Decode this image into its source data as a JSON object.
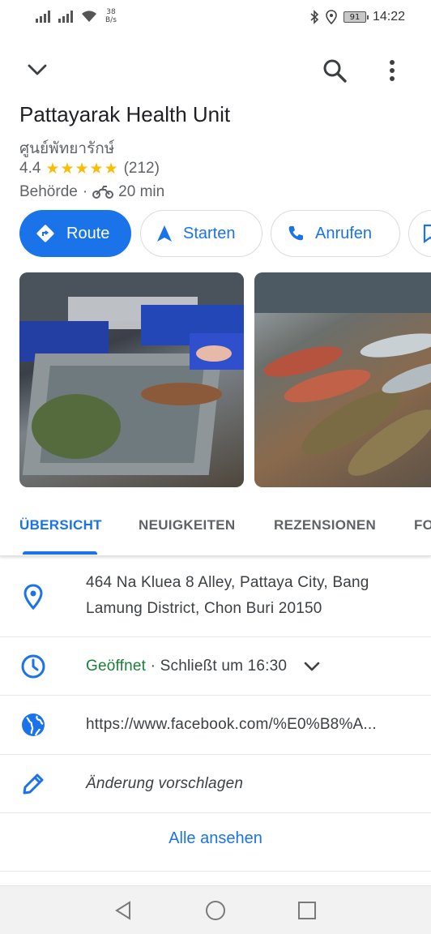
{
  "status_bar": {
    "net_speed_value": "38",
    "net_speed_unit": "B/s",
    "battery": "91",
    "time": "14:22"
  },
  "place": {
    "name": "Pattayarak Health Unit",
    "native_name": "ศูนย์พัทยารักษ์",
    "rating": "4.4",
    "stars": "★★★★★",
    "review_count": "(212)",
    "category": "Behörde",
    "separator": "·",
    "travel_time": "20 min"
  },
  "actions": {
    "route": "Route",
    "start": "Starten",
    "call": "Anrufen"
  },
  "tabs": [
    "ÜBERSICHT",
    "NEUIGKEITEN",
    "REZENSIONEN",
    "FO"
  ],
  "info": {
    "address": "464 Na Kluea 8 Alley, Pattaya City, Bang Lamung District, Chon Buri 20150",
    "open_status": "Geöffnet",
    "hours_separator": " · ",
    "closes": "Schließt um 16:30",
    "website": "https://www.facebook.com/%E0%B8%A...",
    "suggest_edit": "Änderung vorschlagen",
    "see_all": "Alle ansehen"
  },
  "colors": {
    "accent": "#1a73e8",
    "open_green": "#188038",
    "star_yellow": "#fbbc04"
  }
}
